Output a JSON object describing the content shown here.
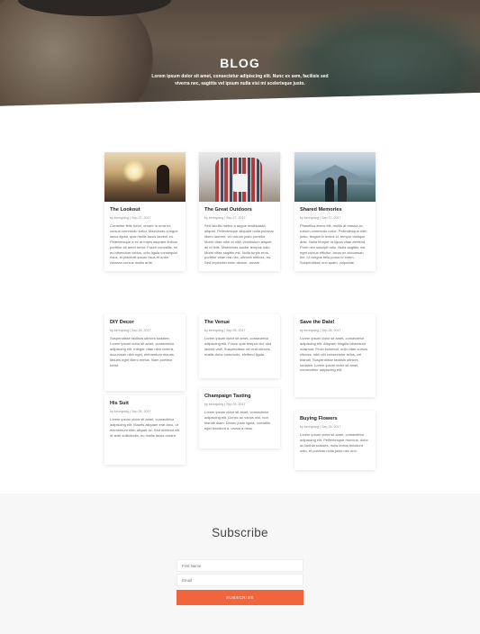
{
  "hero": {
    "title": "BLOG",
    "subtitle": "Lorem ipsum dolor sit amet, consectetur adipiscing elit. Nunc ex sem, facilisis sed viverra nec, sagittis vel ipsum nulla visi mi scelerisque justo."
  },
  "posts": [
    {
      "title": "The Lookout",
      "meta": "by kennyoing | Sep 27, 2017",
      "excerpt": "Curabitur felis tortor, ornare in urna ex, cursus commodo tortor. Maecenas congue lacus ligula, quis mollis lacus laoreet eu. Pellentesque a ex at turpis aliquam finibus porttitor sit amet tortor. Fusce convallis, mi eu bibendum varius, odio ligula consequat risus, et placerat ipsum risus et enim. Aenean cursus mollis ante."
    },
    {
      "title": "The Great Outdoors",
      "meta": "by kennyoing | Sep 27, 2017",
      "excerpt": "Sed iaculis metus a augue malesuada aliquet. Pellentesque aliquam nulla pulvinar libero laoreet, vel rutrum justo porttitor. Morbi vitae nibh et nibh vestibulum aliquet ac id felis. Maecenas auctor tempus odio. Morbi vitae sagittis est. Nulla turpis eros, porttitor vitae nisi nec, ultrices ultrices, eu. Sed imperdiet enim dictum, ornare."
    },
    {
      "title": "Shared Memories",
      "meta": "by kennyoing | Sep 27, 2017",
      "excerpt": "Phasellus libero elit, mollis at massa ac, rutrum commodo tortor. Pellentesque nibh justo, feugiat in lectus id, tempor tristique ante. Nulla tempor ut ligula vitae eleifend. Proin nec suscipit odio. Nulla sagittis, est eget cursus efficitur, lacus ex accumsan leo, id congue felis purus id lorem. Suspendisse orci quam, vulputate."
    },
    {
      "title": "DIY Decor",
      "meta": "by kennyoing | Sep 26, 2017",
      "excerpt": "Suspendisse facilisis ultrices sodales. Lorem ipsum dolor sit amet, consectetur adipiscing elit. Integer vitae nibh viverra, accumsan nibh eget, elementum mauris. Mauris eget libero metus. Nam porttitor tortor."
    },
    {
      "title": "The Venue",
      "meta": "by kennyoing | Sep 26, 2017",
      "excerpt": "Lorem ipsum dolor sit amet, consectetur adipiscing elit. Fusce quis tempor dui, sed lacinia velit. Suspendisse vel erat ultrices, mattis dolor commodo, eleifend ligula."
    },
    {
      "title": "Save the Date!",
      "meta": "by kennyoing | Sep 26, 2017",
      "excerpt": "Lorem ipsum dolor sit amet, consectetur adipiscing elit. Aliquam fringilla bibendum euismod. Proin euismod, odio vitae cursus ultrices, nibh elit consectetur tellus, vel blandit. Suspendisse facilisis ultrices sodales. Lorem ipsum dolor sit amet, consectetur adipiscing elit."
    },
    {
      "title": "His Suit",
      "meta": "by kennyoing | Sep 26, 2017",
      "excerpt": "Lorem ipsum dolor sit amet, consectetur adipiscing elit. Mauris aliquam erat arcu, ut elementum nibh aliquet ac. Sed eleifend elit et ante sollicitudin, eu mollis lacus ornare."
    },
    {
      "title": "Champaign Tasting",
      "meta": "by kennyoing | Sep 26, 2017",
      "excerpt": "Lorem ipsum dolor sit amet, consectetur adipiscing elit. Donec ac varius nisi, non blandit diam. Donec justo ligula, convallis eget tincidunt a, varius a risus."
    },
    {
      "title": "Buying Flowers",
      "meta": "by kennyoing | Sep 26, 2017",
      "excerpt": "Lorem ipsum dolor sit amet, consectetur adipiscing elit. Pellentesque rhoncus, dolor ac lacinia sodales, nulla lectus tincidunt odio, et pulvinar nulla justo nec orci."
    }
  ],
  "subscribe": {
    "title": "Subscribe",
    "first_name_placeholder": "First Name",
    "email_placeholder": "Email",
    "button_label": "SUBSCRIBE"
  },
  "colors": {
    "accent": "#f0653b",
    "subscribe_bg": "#f7f7f7"
  }
}
